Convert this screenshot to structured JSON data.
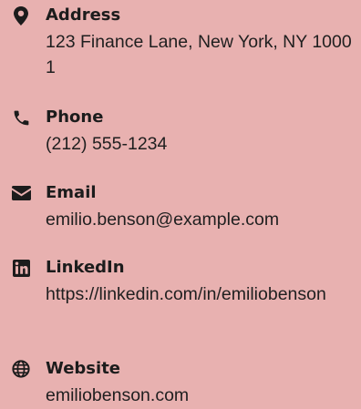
{
  "contacts": [
    {
      "id": "address",
      "icon": "map-marker-icon",
      "label": "Address",
      "value": "123 Finance Lane, New York, NY 10001"
    },
    {
      "id": "phone",
      "icon": "phone-icon",
      "label": "Phone",
      "value": "(212) 555-1234"
    },
    {
      "id": "email",
      "icon": "envelope-icon",
      "label": "Email",
      "value": "emilio.benson@example.com"
    },
    {
      "id": "linkedin",
      "icon": "linkedin-icon",
      "label": "LinkedIn",
      "value": "https://linkedin.com/in/emiliobenson"
    },
    {
      "id": "website",
      "icon": "globe-icon",
      "label": "Website",
      "value": "emiliobenson.com"
    }
  ]
}
